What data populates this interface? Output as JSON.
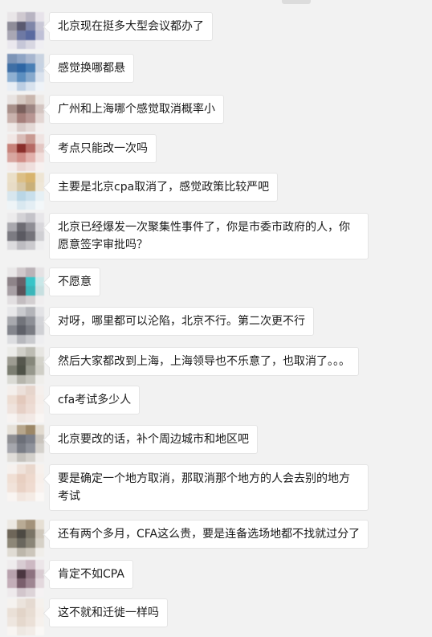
{
  "messages": [
    {
      "text": "北京现在挺多大型会议都办了",
      "avatar_colors": [
        "#e9e6e8",
        "#cfc9d0",
        "#b8b4c2",
        "#e7e3ea",
        "#8f8d99",
        "#5a5a70",
        "#7f86a8",
        "#c9c8d6",
        "#a9a7b4",
        "#6e79a4",
        "#5a6aa0",
        "#bfc0d6",
        "#eae8ee",
        "#c6c7d8",
        "#d8d7e2",
        "#f0eff3"
      ]
    },
    {
      "text": "感觉换哪都悬",
      "avatar_colors": [
        "#7d95b7",
        "#8ea4c4",
        "#a7b6cf",
        "#c9d3e1",
        "#3f6fa5",
        "#2e66a4",
        "#4a7fb5",
        "#c7d3e3",
        "#8eb0d2",
        "#5c8fc0",
        "#87a9cd",
        "#dbe3ee",
        "#e8eef5",
        "#bccee3",
        "#d8e2ee",
        "#eff3f8"
      ]
    },
    {
      "text": "广州和上海哪个感觉取消概率小",
      "avatar_colors": [
        "#e8e3e1",
        "#d6c9c2",
        "#c9b6ad",
        "#ece7e4",
        "#a8908a",
        "#7a5f5c",
        "#9c8582",
        "#d3c5c1",
        "#c9b2ad",
        "#a67f7b",
        "#b89693",
        "#e3d6d3",
        "#efe9e7",
        "#d9cbc8",
        "#e4d9d6",
        "#f4f0ef"
      ]
    },
    {
      "text": "考点只能改一次吗",
      "avatar_colors": [
        "#f1e7e5",
        "#d9bcb7",
        "#c99a92",
        "#efe3e1",
        "#c7827a",
        "#8a2e2a",
        "#b66a64",
        "#e3c7c3",
        "#d8a6a0",
        "#d18d87",
        "#e2b0ab",
        "#f1dedb",
        "#f4eceb",
        "#ead5d2",
        "#efdfdd",
        "#f7f1f0"
      ]
    },
    {
      "text": "主要是北京cpa取消了，感觉政策比较严吧",
      "avatar_colors": [
        "#eadfc8",
        "#dcbf86",
        "#d8b46e",
        "#eee5d4",
        "#e8dcc6",
        "#d7c7a6",
        "#c9b07a",
        "#efe7d8",
        "#d7e6ee",
        "#b9d6e6",
        "#c8dfec",
        "#e6f0f5",
        "#eef4f7",
        "#d9e8f0",
        "#e4eef4",
        "#f3f7f9"
      ]
    },
    {
      "text": "北京已经爆发一次聚集性事件了，你是市委市政府的人，你愿意签字审批吗？",
      "wrap": true,
      "avatar_colors": [
        "#ecebec",
        "#d3d2d6",
        "#c4c3c9",
        "#e7e6e9",
        "#a9a8ae",
        "#6d6c73",
        "#8f8e95",
        "#d8d7db",
        "#7c7b82",
        "#5b5a62",
        "#74737a",
        "#cfcfd3",
        "#dcdbde",
        "#bdbcc1",
        "#cbcace",
        "#eeeeef"
      ]
    },
    {
      "text": "不愿意",
      "avatar_colors": [
        "#e9e7e8",
        "#cfc8cb",
        "#bab2b7",
        "#e5e2e4",
        "#8e8489",
        "#6a5f66",
        "#38c4c8",
        "#c9e7e8",
        "#a8a0a5",
        "#5d5258",
        "#3bb6ba",
        "#c7dfe0",
        "#e2dfe1",
        "#c3bdc0",
        "#d3cfd1",
        "#f0eeef"
      ]
    },
    {
      "text": "对呀，哪里都可以沦陷，北京不行。第二次更不行",
      "avatar_colors": [
        "#e8e8ea",
        "#c9cace",
        "#b3b4b9",
        "#e3e3e6",
        "#a8a9ae",
        "#72747b",
        "#8d8f96",
        "#d3d4d8",
        "#84868d",
        "#5f6169",
        "#7a7c83",
        "#cfd0d4",
        "#dcdde0",
        "#b7b8bd",
        "#c9cace",
        "#eeeef0"
      ]
    },
    {
      "text": "然后大家都改到上海，上海领导也不乐意了，也取消了。。。",
      "avatar_colors": [
        "#ecece9",
        "#d0cfc8",
        "#bdbcb3",
        "#e7e6e2",
        "#9d9c92",
        "#56574e",
        "#86877b",
        "#d4d3cb",
        "#7c7e72",
        "#4f5248",
        "#96978c",
        "#cfcec6",
        "#dadad4",
        "#b6b5ac",
        "#c6c5bd",
        "#efeeeb"
      ]
    },
    {
      "text": "cfa考试多少人",
      "avatar_colors": [
        "#f4efec",
        "#ece0da",
        "#e6d5cc",
        "#f5f0ed",
        "#edddd3",
        "#e3c9bc",
        "#ebd8cf",
        "#f5eeea",
        "#efe3dd",
        "#e6d0c6",
        "#eddcd4",
        "#f6f0ed",
        "#f7f3f1",
        "#efe6e1",
        "#f2e9e5",
        "#f9f6f4"
      ]
    },
    {
      "text": "北京要改的话，补个周边城市和地区吧",
      "avatar_colors": [
        "#e6e1d9",
        "#b7a68c",
        "#9c8767",
        "#e2dbd0",
        "#8f8f93",
        "#6c6f78",
        "#7c7f89",
        "#c9c4bd",
        "#a6a7ad",
        "#7a7d86",
        "#8f929b",
        "#d4d1cc",
        "#e0ddd9",
        "#c4c1bc",
        "#d3d0cb",
        "#f0eeec"
      ]
    },
    {
      "text": "要是确定一个地方取消，那取消那个地方的人会去别的地方考试",
      "wrap": true,
      "avatar_colors": [
        "#f6f1ee",
        "#efe2da",
        "#e9d7cc",
        "#f7f1ed",
        "#f0dfd4",
        "#e8cfc1",
        "#eed9cd",
        "#f7efea",
        "#f1e3da",
        "#e9d2c5",
        "#efdbd0",
        "#f8f1ed",
        "#f9f5f2",
        "#f1e6df",
        "#f4ebe5",
        "#fbf8f6"
      ]
    },
    {
      "text": "还有两个多月，CFA这么贵，要是连备选场地都不找就过分了",
      "avatar_colors": [
        "#ece8e2",
        "#b9ab95",
        "#a3927a",
        "#e6dfd4",
        "#6e6659",
        "#4d4a43",
        "#7a7466",
        "#cfc8bc",
        "#8d8778",
        "#6a675e",
        "#8a8577",
        "#d6d1c7",
        "#e0dcd4",
        "#bdb7ab",
        "#ccc6bb",
        "#f0eeea"
      ]
    },
    {
      "text": "肯定不如CPA",
      "avatar_colors": [
        "#efeced",
        "#d8ccd2",
        "#cdb9c3",
        "#ece6e9",
        "#b8a2ad",
        "#4b3640",
        "#8d727f",
        "#d9ccd2",
        "#c3aeb8",
        "#7a5f6c",
        "#9e8591",
        "#e3d8dd",
        "#eeeaec",
        "#d2c6cc",
        "#ddd4d8",
        "#f5f2f3"
      ]
    },
    {
      "text": "这不就和迁徙一样吗",
      "avatar_colors": [
        "#f5f2ef",
        "#ebe3dc",
        "#e5dad1",
        "#f5f1ed",
        "#eae0d7",
        "#e2d4c8",
        "#e8ddd3",
        "#f5efea",
        "#eee6df",
        "#e5d8cd",
        "#ebe0d7",
        "#f6f1ed",
        "#f8f5f2",
        "#eee8e2",
        "#f2ece7",
        "#faf8f6"
      ]
    }
  ]
}
